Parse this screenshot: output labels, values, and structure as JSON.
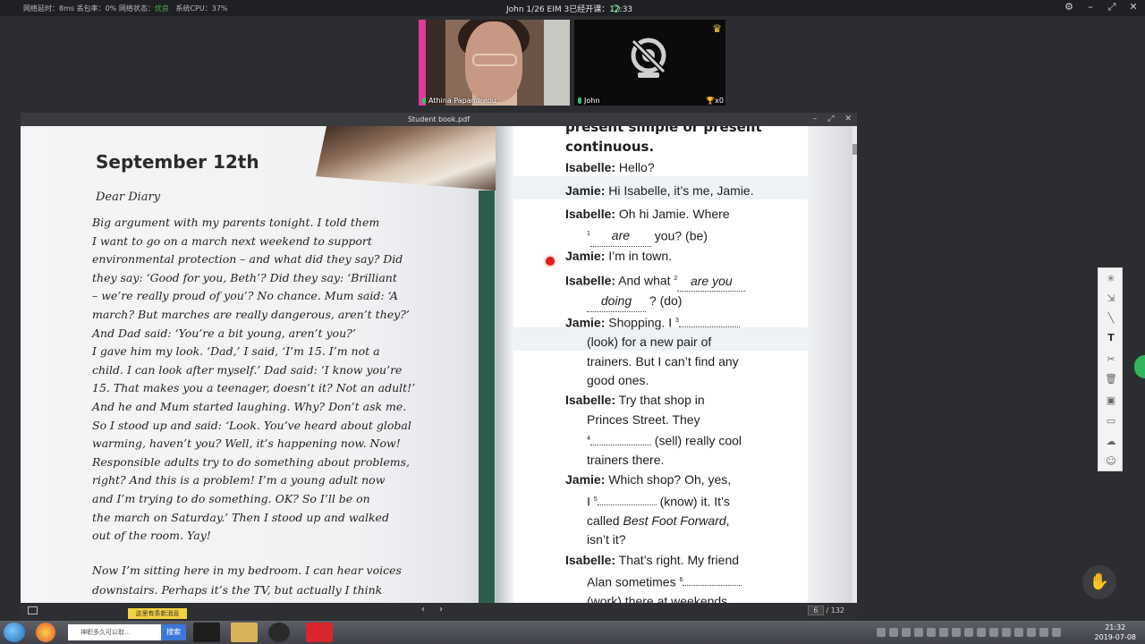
{
  "status_bar": {
    "network_info": "网络延时：8ms 丢包率：0% 网络状态：",
    "network_quality": "优良",
    "cpu": "系统CPU：37%",
    "class_name": "John 1/26 EIM 3",
    "elapsed": "已经开课：12:33"
  },
  "videos": [
    {
      "name": "Athina Papandreou"
    },
    {
      "name": "John",
      "trophies": "x0"
    }
  ],
  "pdf": {
    "title": "Student book.pdf",
    "current_page": "6",
    "total_pages": "/ 132"
  },
  "left_page": {
    "date_heading": "September 12th",
    "salutation": "Dear Diary",
    "lines": [
      "Big argument with my parents tonight. I told them",
      "I want to go on a march next weekend to support",
      "environmental protection – and what did they say? Did",
      "they say: ‘Good for you, Beth’? Did they say: ‘Brilliant",
      "– we’re really proud of you’? No chance. Mum said: ‘A",
      "march? But marches are really dangerous, aren’t they?’",
      "And Dad said: ‘You’re a bit young, aren’t you?’",
      "I gave him my look. ‘Dad,’ I said, ‘I’m 15. I’m not a",
      "child. I can look after myself.’ Dad said: ‘I know you’re",
      "15. That makes you a teenager, doesn’t it? Not an adult!’",
      "And he and Mum started laughing. Why? Don’t ask me.",
      "So I stood up and said: ‘Look. You’ve heard about global",
      "warming, haven’t you? Well, it’s happening now. Now!",
      "Responsible adults try to do something about problems,",
      "right? And this is a problem! I’m a young adult now",
      "and I’m trying to do something. OK? So I’ll be on",
      "the march on Saturday.’ Then I stood up and walked",
      "out of the room. Yay!"
    ],
    "lines2": [
      "Now I’m sitting here in my bedroom. I can hear voices",
      "downstairs. Perhaps it’s the TV, but actually I think"
    ]
  },
  "right_page": {
    "heading_1": "present simple or present",
    "heading_2": "continuous.",
    "d1_speaker": "Isabelle:",
    "d1_text": "Hello?",
    "d2_speaker": "Jamie:",
    "d2_text": "Hi Isabelle, it’s me, Jamie.",
    "d3_speaker": "Isabelle:",
    "d3_text": "Oh hi Jamie. Where",
    "d3_num": "1",
    "d3_blank": "are",
    "d3_after": "you? (be)",
    "d4_speaker": "Jamie:",
    "d4_text": "I’m in town.",
    "d5_speaker": "Isabelle:",
    "d5_text": "And what",
    "d5_num": "2",
    "d5_blank": "are you",
    "d5_blank2": "doing",
    "d5_after": "? (do)",
    "d6_speaker": "Jamie:",
    "d6_text": "Shopping. I",
    "d6_num": "3",
    "d6_l2": "(look) for a new pair of",
    "d6_l3": "trainers. But I can’t find any",
    "d6_l4": "good ones.",
    "d7_speaker": "Isabelle:",
    "d7_text": "Try that shop in",
    "d7_l2": "Princes Street. They",
    "d7_num": "4",
    "d7_after": "(sell) really cool",
    "d7_l4": "trainers there.",
    "d8_speaker": "Jamie:",
    "d8_text": "Which shop? Oh, yes,",
    "d8_i": "I",
    "d8_num": "5",
    "d8_after": "(know) it. It’s",
    "d8_l3a": "called",
    "d8_l3b": "Best Foot Forward",
    "d8_l3c": ",",
    "d8_l4": "isn’t it?",
    "d9_speaker": "Isabelle:",
    "d9_text": "That’s right. My friend",
    "d9_l2": "Alan sometimes",
    "d9_num": "6",
    "d9_l3": "(work) there at weekends."
  },
  "taskbar": {
    "search_placeholder": "神职多久可以取...",
    "search_button": "搜索",
    "notice": "这里有条新消息",
    "time": "21:32",
    "date": "2019-07-08"
  },
  "icons": [
    "settings-icon",
    "minimize-icon",
    "restore-icon",
    "close-icon",
    "camera-off-icon",
    "crown-icon",
    "trophy-icon",
    "raise-hand-icon"
  ]
}
